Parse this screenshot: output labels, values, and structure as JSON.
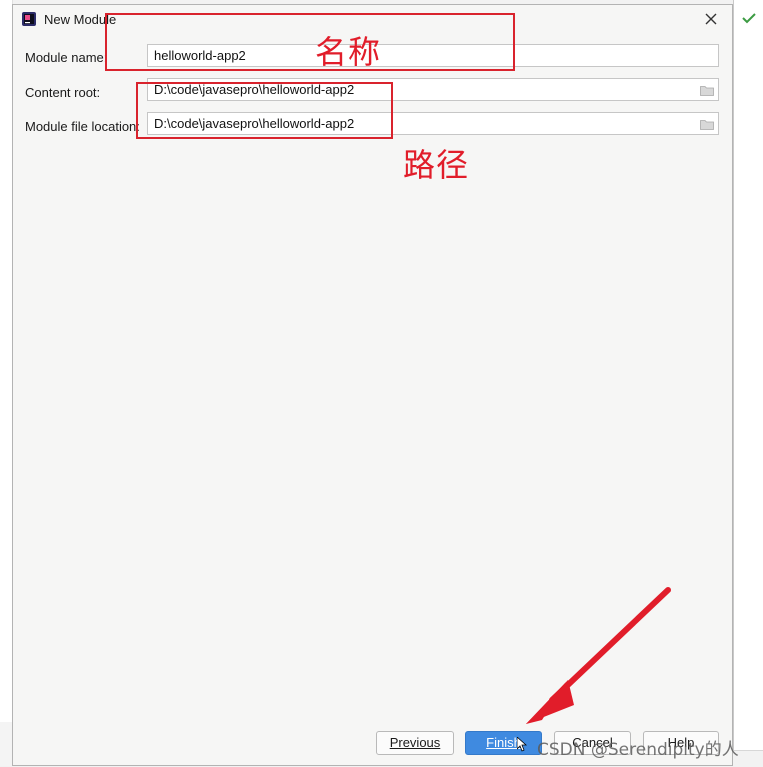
{
  "window": {
    "title": "New Module"
  },
  "form": {
    "module_name_label": "Module name:",
    "module_name_value": "helloworld-app2",
    "content_root_label": "Content root:",
    "content_root_value": "D:\\code\\javasepro\\helloworld-app2",
    "module_file_location_label": "Module file location:",
    "module_file_location_value": "D:\\code\\javasepro\\helloworld-app2"
  },
  "annotations": {
    "name_text": "名称",
    "path_text": "路径"
  },
  "buttons": {
    "previous": "Previous",
    "finish": "Finish",
    "cancel": "Cancel",
    "help": "Help"
  },
  "watermark": "CSDN @Serendipity的人",
  "colors": {
    "annotation_red": "#e11d2a",
    "primary_button": "#3f8ae0",
    "dialog_background": "#f6f6f5"
  },
  "icons": [
    "app-icon",
    "close-icon",
    "folder-icon",
    "arrow-annotation",
    "mouse-cursor-icon"
  ]
}
